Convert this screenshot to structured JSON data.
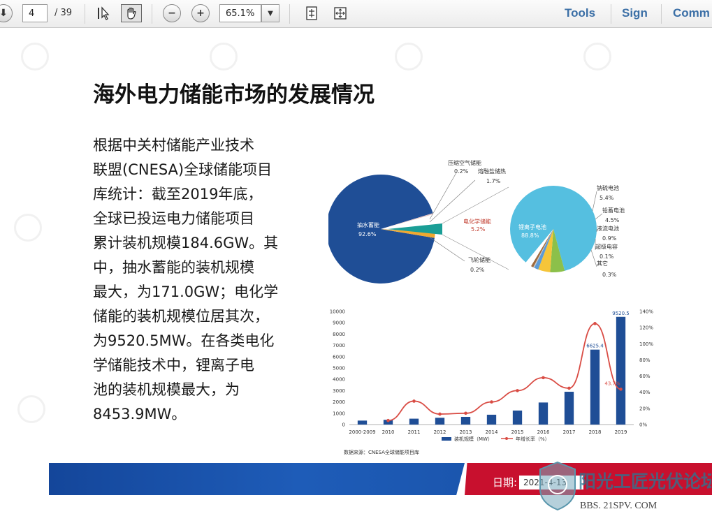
{
  "toolbar": {
    "page_current": "4",
    "page_total": "/ 39",
    "zoom": "65.1%",
    "tools_label": "Tools",
    "sign_label": "Sign",
    "comment_label": "Comm"
  },
  "slide": {
    "title": "海外电力储能市场的发展情况",
    "body_lines": [
      "根据中关村储能产业技术",
      "联盟(CNESA)全球储能项目",
      "库统计：截至2019年底，",
      "全球已投运电力储能项目",
      "累计装机规模184.6GW。其",
      "中，抽水蓄能的装机规模",
      "最大，为171.0GW；电化学",
      "储能的装机规模位居其次，",
      "为9520.5MW。在各类电化",
      "学储能技术中，锂离子电",
      "池的装机规模最大，为",
      "8453.9MW。"
    ],
    "footer_date_label": "日期:",
    "footer_date_value": "2021-4-13",
    "brand_text": "阳光工匠光伏论坛",
    "brand_url": "BBS. 21SPV. COM"
  },
  "chart_data": [
    {
      "type": "pie",
      "labels": [
        "抽水蓄能",
        "电化学储能",
        "压缩空气储能",
        "熔融盐储热",
        "飞轮储能"
      ],
      "values": [
        92.6,
        5.2,
        0.2,
        1.7,
        0.2
      ],
      "value_labels": [
        "92.6%",
        "5.2%",
        "0.2%",
        "1.7%",
        "0.2%"
      ],
      "colors": [
        "#1f4e96",
        "#1a9e96",
        "#9fb6d6",
        "#f0a830",
        "#e2c2c2"
      ]
    },
    {
      "type": "pie",
      "labels": [
        "锂离子电池",
        "钠硫电池",
        "铅蓄电池",
        "液流电池",
        "超级电容",
        "其它"
      ],
      "values": [
        88.8,
        5.4,
        4.5,
        0.9,
        0.1,
        0.3
      ],
      "value_labels": [
        "88.8%",
        "5.4%",
        "4.5%",
        "0.9%",
        "0.1%",
        "0.3%"
      ],
      "colors": [
        "#55bfe0",
        "#8cc04a",
        "#f5c53a",
        "#5c9bd6",
        "#c9c9c9",
        "#9e6b3e"
      ]
    },
    {
      "type": "bar",
      "categories": [
        "2000-2009",
        "2010",
        "2011",
        "2012",
        "2013",
        "2014",
        "2015",
        "2016",
        "2017",
        "2018",
        "2019"
      ],
      "series": [
        {
          "name": "装机规模（MW）",
          "values": [
            350,
            420,
            520,
            600,
            680,
            870,
            1240,
            1950,
            2900,
            6625.4,
            9520.5
          ],
          "color": "#1f4e96"
        },
        {
          "name": "年增长率（%）",
          "values": [
            null,
            5,
            29,
            13,
            14,
            28,
            42,
            58,
            45,
            125,
            43.7
          ],
          "color": "#d94c44",
          "axis": "right"
        }
      ],
      "data_labels": {
        "2018": "6625.4",
        "2019": "9520.5"
      },
      "annotation": "43.7%",
      "ylim_left": [
        0,
        10000
      ],
      "yticks_left": [
        "0",
        "1000",
        "2000",
        "3000",
        "4000",
        "5000",
        "6000",
        "7000",
        "8000",
        "9000",
        "10000"
      ],
      "ylim_right": [
        0,
        140
      ],
      "yticks_right": [
        "0%",
        "20%",
        "40%",
        "60%",
        "80%",
        "100%",
        "120%",
        "140%"
      ],
      "source": "数据来源：CNESA全球储能项目库"
    }
  ]
}
